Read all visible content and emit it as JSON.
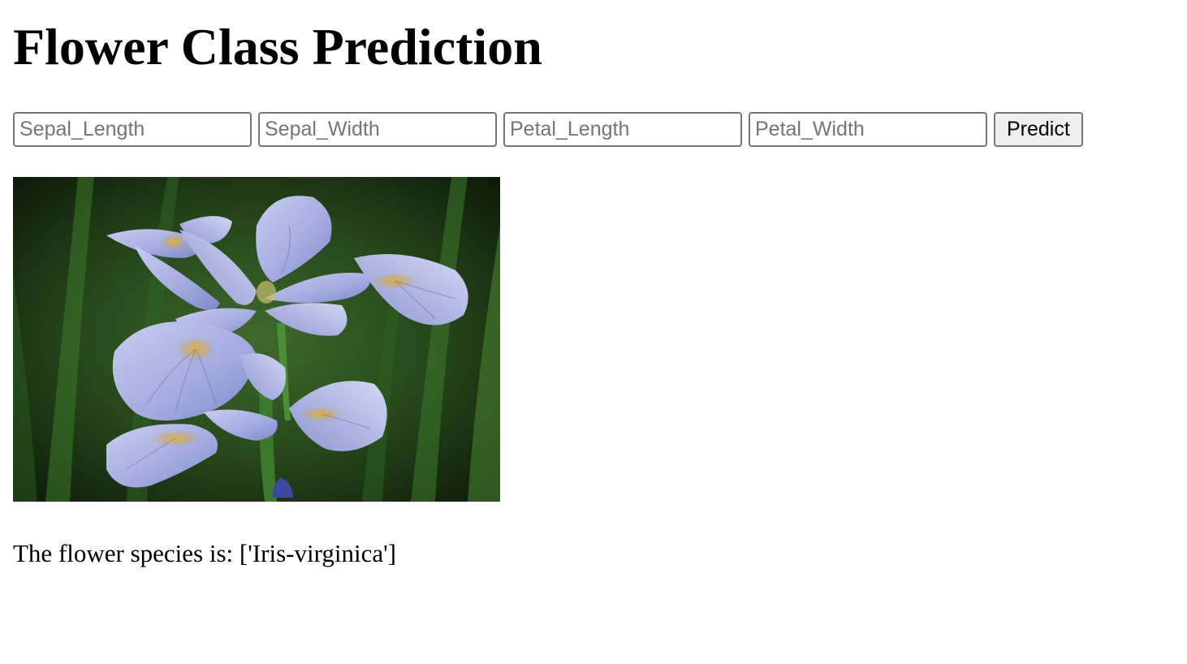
{
  "page": {
    "title": "Flower Class Prediction"
  },
  "form": {
    "inputs": [
      {
        "placeholder": "Sepal_Length",
        "value": ""
      },
      {
        "placeholder": "Sepal_Width",
        "value": ""
      },
      {
        "placeholder": "Petal_Length",
        "value": ""
      },
      {
        "placeholder": "Petal_Width",
        "value": ""
      }
    ],
    "submit_label": "Predict"
  },
  "image": {
    "subject": "iris-flower-photo"
  },
  "result": {
    "text": "The flower species is: ['Iris-virginica']"
  },
  "colors": {
    "background": "#ffffff",
    "text": "#000000",
    "input_border": "#767676",
    "button_bg": "#efefef",
    "petal": "#aab1e2",
    "petal_accent": "#d2a22c",
    "foliage": "#2f5a22"
  }
}
